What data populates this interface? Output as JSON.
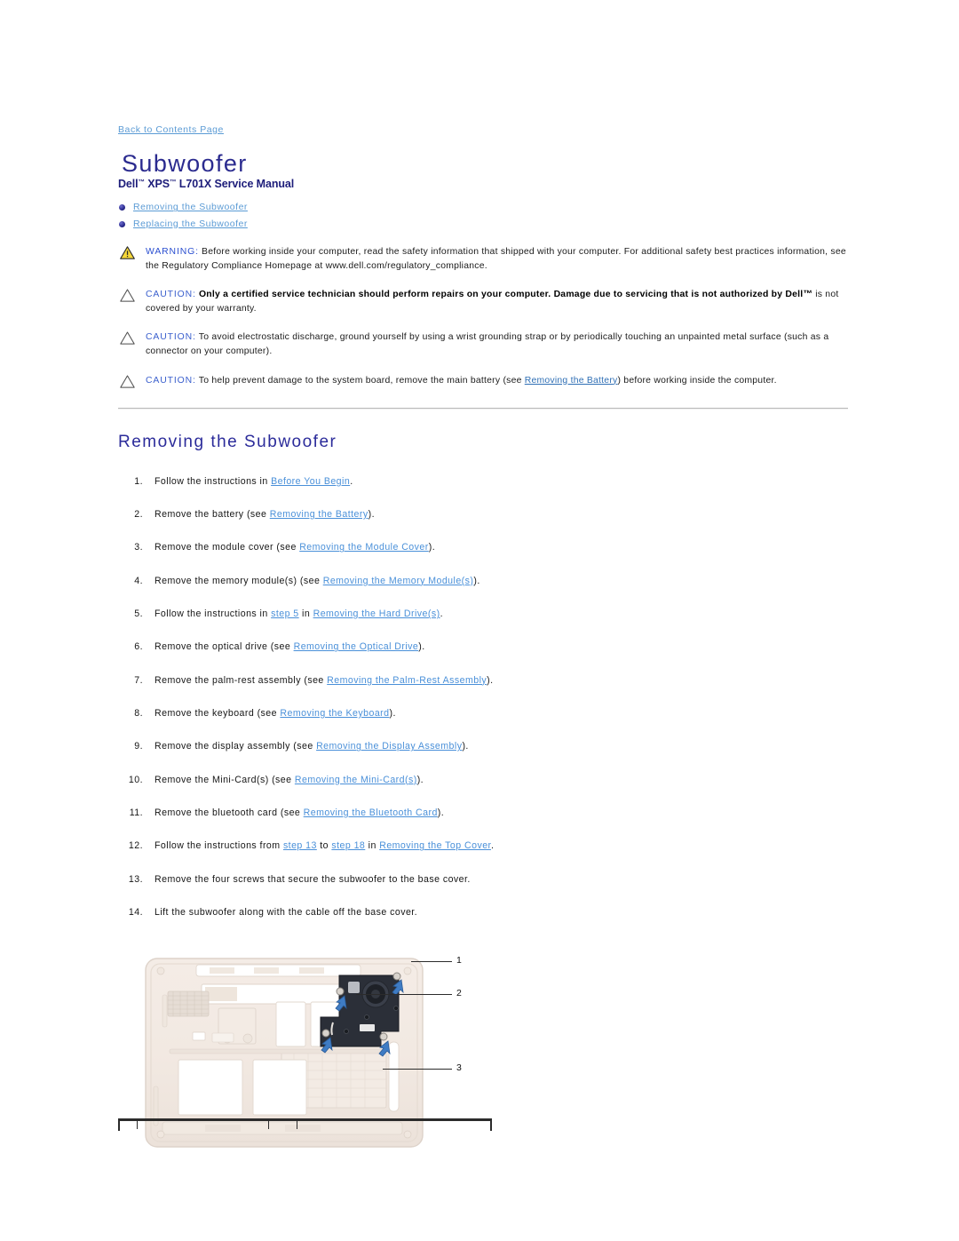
{
  "page": {
    "back_link": "Back to Contents Page",
    "title": "Subwoofer",
    "subtitle_pre": "Dell",
    "subtitle_tm1": "™",
    "subtitle_mid": " XPS",
    "subtitle_tm2": "™",
    "subtitle_post": " L701X Service Manual"
  },
  "toc": {
    "items": [
      {
        "label": "Removing the Subwoofer"
      },
      {
        "label": "Replacing the Subwoofer"
      }
    ]
  },
  "notices": [
    {
      "icon": "warning-triangle-filled-icon",
      "label": "WARNING:",
      "text": " Before working inside your computer, read the safety information that shipped with your computer. For additional safety best practices information, see the Regulatory Compliance Homepage at www.dell.com/regulatory_compliance."
    },
    {
      "icon": "caution-triangle-outline-icon",
      "label": "CAUTION:",
      "bold_text": " Only a certified service technician should perform repairs on your computer. Damage due to servicing that is not authorized by Dell™",
      "text": " is not covered by your warranty."
    },
    {
      "icon": "caution-triangle-outline-icon",
      "label": "CAUTION:",
      "text": " To avoid electrostatic discharge, ground yourself by using a wrist grounding strap or by periodically touching an unpainted metal surface (such as a connector on your computer)."
    },
    {
      "icon": "caution-triangle-outline-icon",
      "label": "CAUTION:",
      "text_before": " To help prevent damage to the system board, remove the main battery (see ",
      "link": "Removing the Battery",
      "text_after": ") before working inside the computer."
    }
  ],
  "section": {
    "heading": "Removing the Subwoofer",
    "steps": [
      {
        "before": "Follow the instructions in ",
        "link": "Before You Begin",
        "after": "."
      },
      {
        "before": "Remove the battery (see ",
        "link": "Removing the Battery",
        "after": ")."
      },
      {
        "before": "Remove the module cover (see ",
        "link": "Removing the Module Cover",
        "after": ")."
      },
      {
        "before": "Remove the memory module(s) (see ",
        "link": "Removing the Memory Module(s)",
        "after": ")."
      },
      {
        "before": "Follow the instructions in ",
        "link": "step 5",
        "mid": " in ",
        "link2": "Removing the Hard Drive(s)",
        "after": "."
      },
      {
        "before": "Remove the optical drive (see ",
        "link": "Removing the Optical Drive",
        "after": ")."
      },
      {
        "before": "Remove the palm-rest assembly (see ",
        "link": "Removing the Palm-Rest Assembly",
        "after": ")."
      },
      {
        "before": "Remove the keyboard (see ",
        "link": "Removing the Keyboard",
        "after": ")."
      },
      {
        "before": "Remove the display assembly (see ",
        "link": "Removing the Display Assembly",
        "after": ")."
      },
      {
        "before": "Remove the Mini-Card(s) (see ",
        "link": "Removing the Mini-Card(s)",
        "after": ")."
      },
      {
        "before": "Remove the bluetooth card (see ",
        "link": "Removing the Bluetooth Card",
        "after": ")."
      },
      {
        "before": "Follow the instructions from ",
        "link": "step 13",
        "mid": " to ",
        "link2": "step 18",
        "mid2": " in ",
        "link3": "Removing the Top Cover",
        "after": "."
      },
      {
        "before": "Remove the four screws that secure the subwoofer to the base cover.",
        "link": "",
        "after": ""
      },
      {
        "before": "Lift the subwoofer along with the cable off the base cover.",
        "link": "",
        "after": ""
      }
    ]
  },
  "figure": {
    "alt": "Laptop base cover with subwoofer installed",
    "callouts": [
      {
        "number": "1"
      },
      {
        "number": "2"
      },
      {
        "number": "3"
      }
    ]
  },
  "colors": {
    "title_navy": "#2b2b8f",
    "link_blue": "#5b9bd5",
    "notice_label_blue": "#3a5fcd",
    "warning_triangle": "#f5d020",
    "callout_arrow": "#2f6fb5"
  }
}
